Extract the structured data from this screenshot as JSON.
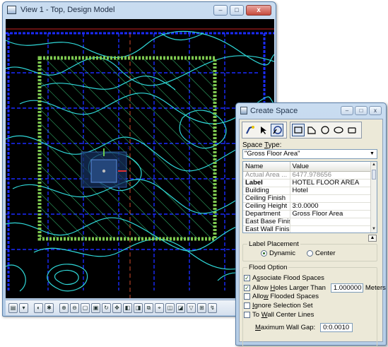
{
  "view_window": {
    "title": "View 1 - Top, Design Model",
    "controls": {
      "minimize": "–",
      "maximize": "□",
      "close": "x"
    },
    "toolbar_icons": [
      "view-attributes-icon",
      "level-display-icon",
      "display-style-icon",
      "update-view-icon",
      "zoom-in-icon",
      "zoom-out-icon",
      "window-area-icon",
      "fit-view-icon",
      "rotate-view-icon",
      "pan-view-icon",
      "view-previous-icon",
      "view-next-icon",
      "copy-view-icon",
      "camera-icon",
      "clip-volume-icon",
      "clip-mask-icon",
      "clip-front-icon",
      "clip-back-icon",
      "toggle-icon"
    ],
    "colors": {
      "background": "#000000",
      "contours": "#2fd8d8",
      "grid": "#1a2bff",
      "boundary": "#7ec850",
      "hatch": "#38c878"
    }
  },
  "dialog": {
    "title": "Create Space",
    "controls": {
      "minimize": "–",
      "maximize": "□",
      "close": "x"
    },
    "tools": [
      "place-flood-icon",
      "select-icon",
      "place-shape-icon",
      "rectangle-icon",
      "orthogonal-shape-icon",
      "circle-icon",
      "ellipse-icon",
      "block-icon"
    ],
    "space_type_label_pre": "Space ",
    "space_type_label_u": "T",
    "space_type_label_post": "ype:",
    "space_type_value": "\"Gross Floor Area\"",
    "table": {
      "headers": [
        "Name",
        "Value"
      ],
      "rows": [
        {
          "name": "Actual Area ...",
          "value": "6477.978656"
        },
        {
          "name": "Label",
          "value": "HOTEL FLOOR AREA"
        },
        {
          "name": "Building",
          "value": "Hotel"
        },
        {
          "name": "Ceiling Finish",
          "value": ""
        },
        {
          "name": "Ceiling Height",
          "value": "3:0.0000"
        },
        {
          "name": "Department",
          "value": "Gross Floor Area"
        },
        {
          "name": "East Base Finish",
          "value": ""
        },
        {
          "name": "East Wall Finish",
          "value": ""
        }
      ]
    },
    "label_placement": {
      "legend": "Label Placement",
      "options": [
        "Dynamic",
        "Center"
      ],
      "selected": "Dynamic"
    },
    "flood_option": {
      "legend": "Flood Option",
      "associate": {
        "pre": "A",
        "u": "s",
        "post": "sociate Flood Spaces",
        "checked": true
      },
      "allow_holes": {
        "pre": "Allow ",
        "u": "H",
        "post": "oles Larger Than",
        "checked": true,
        "value": "1.000000",
        "unit": "Meters"
      },
      "allow_flooded": {
        "pre": "Allo",
        "u": "w",
        "post": " Flooded Spaces",
        "checked": false
      },
      "ignore_selection": {
        "pre": "",
        "u": "I",
        "post": "gnore Selection Set",
        "checked": false
      },
      "to_wall": {
        "pre": "To ",
        "u": "W",
        "post": "all Center Lines",
        "checked": false
      },
      "max_wall_gap": {
        "pre": "",
        "u": "M",
        "post": "aximum Wall Gap:",
        "value": "0:0.0010"
      }
    }
  }
}
